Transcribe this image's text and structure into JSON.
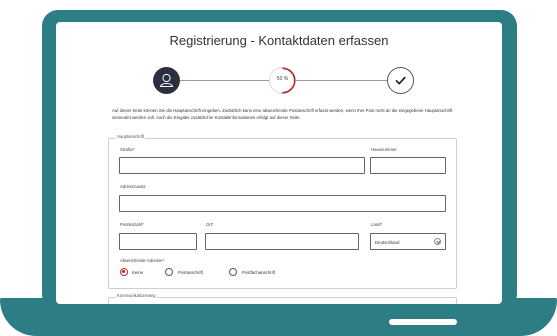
{
  "page": {
    "title": "Registrierung - Kontaktdaten erfassen",
    "intro": "Auf dieser Seite können Sie die Hauptanschrift eingeben. Zusätzlich kann eine abweichende Postanschrift erfasst werden, wenn Ihre Post nicht an die eingegebene Hauptanschrift versendet werden soll. Auch die Eingabe zusätzlicher Kontaktinformationen erfolgt auf dieser Seite."
  },
  "stepper": {
    "progress_label": "50 %",
    "progress_fraction": 0.5,
    "accent_color": "#c0262e",
    "step1_icon": "user-icon",
    "step3_icon": "check-icon"
  },
  "address": {
    "legend": "Hauptanschrift",
    "street_label": "Straße*",
    "house_number_label": "Hausnummer",
    "address_extra_label": "Adresszusatz",
    "postal_code_label": "Postleitzahl*",
    "city_label": "Ort*",
    "country_label": "Land*",
    "country_value": "Deutschland",
    "alt_address_label": "Abweichende Adresse*",
    "alt_options": [
      "Keine",
      "Postanschrift",
      "Postfachanschrift"
    ],
    "alt_selected": "Keine"
  },
  "communication": {
    "legend": "Kommunikationsweg"
  },
  "colors": {
    "frame": "#2d7d84",
    "step_active": "#2b3040",
    "radio_selected": "#c0262e"
  }
}
